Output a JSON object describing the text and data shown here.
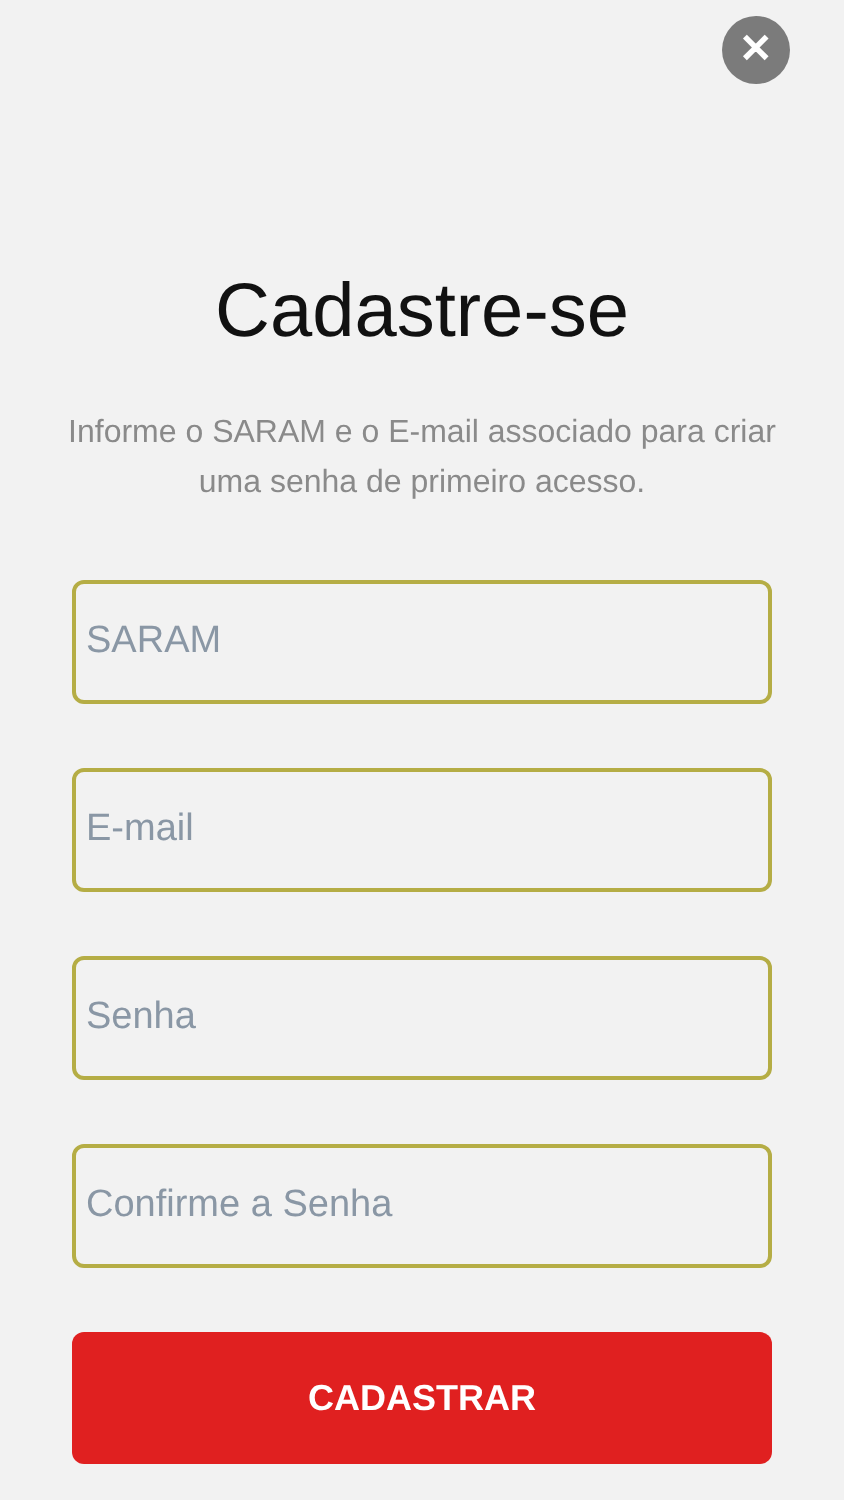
{
  "close_button": {
    "label": "✕"
  },
  "title": "Cadastre-se",
  "subtitle": "Informe o SARAM e o E-mail associado para criar uma senha de primeiro acesso.",
  "fields": [
    {
      "placeholder": "SARAM"
    },
    {
      "placeholder": "E-mail"
    },
    {
      "placeholder": "Senha"
    },
    {
      "placeholder": "Confirme a Senha"
    }
  ],
  "submit_button": "CADASTRAR"
}
